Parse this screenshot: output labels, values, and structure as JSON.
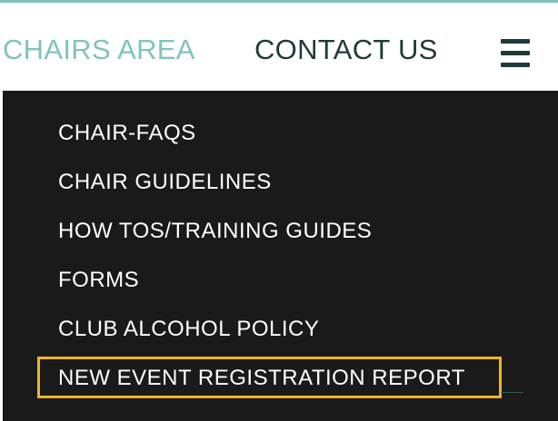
{
  "header": {
    "links": [
      {
        "label": "CHAIRS AREA"
      },
      {
        "label": "CONTACT US"
      }
    ],
    "menu_icon": "hamburger-menu-icon"
  },
  "dropdown": {
    "items": [
      {
        "label": "CHAIR-FAQS"
      },
      {
        "label": "CHAIR GUIDELINES"
      },
      {
        "label": "HOW TOS/TRAINING GUIDES"
      },
      {
        "label": "FORMS"
      },
      {
        "label": "CLUB ALCOHOL POLICY"
      },
      {
        "label": "NEW EVENT REGISTRATION REPORT"
      }
    ],
    "highlighted_index": 5
  },
  "colors": {
    "accent_teal": "#7fc4bd",
    "nav_dark": "#1f3a3a",
    "menu_bg": "#1a1a1a",
    "menu_text": "#ffffff",
    "highlight": "#f0b429",
    "top_rule": "#7fc4bd",
    "underline": "#2e5e5a"
  }
}
